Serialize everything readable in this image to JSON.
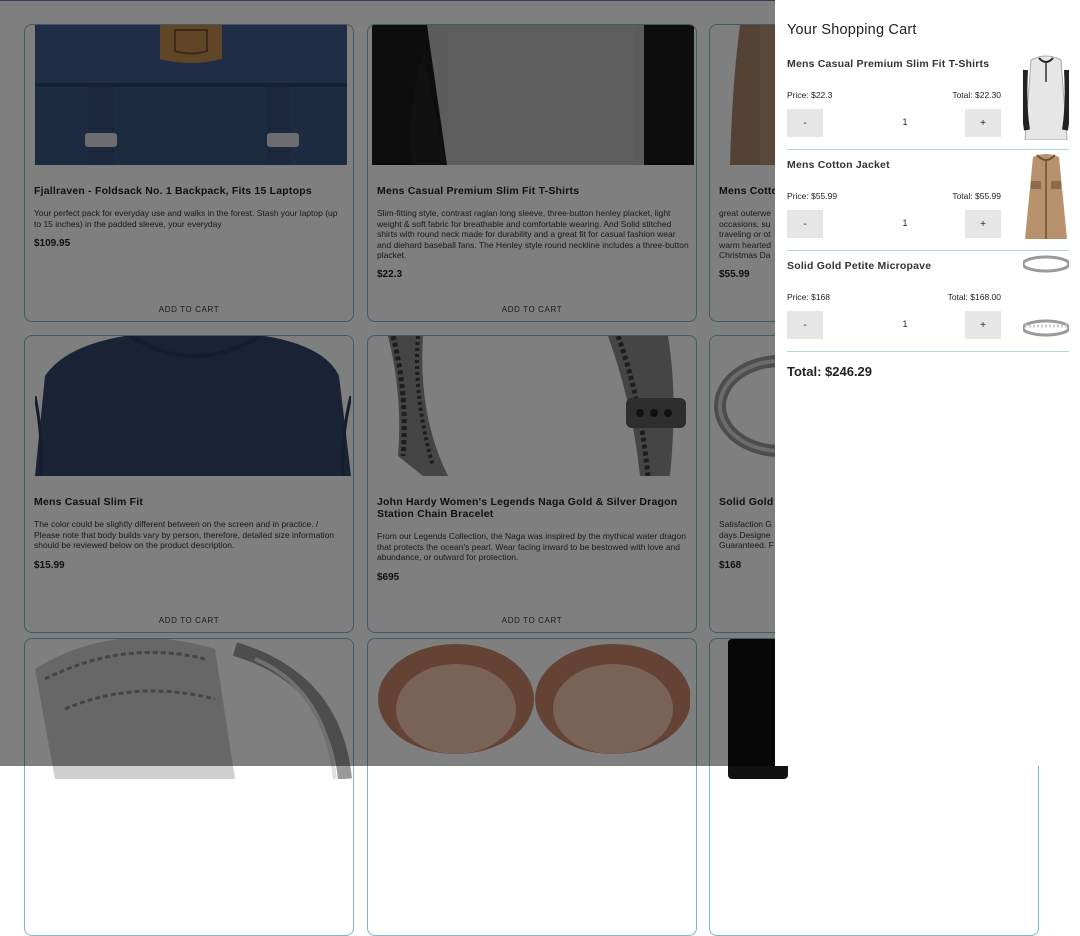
{
  "products": [
    {
      "title": "Fjallraven - Foldsack No. 1 Backpack, Fits 15 Laptops",
      "description": "Your perfect pack for everyday use and walks in the forest. Stash your laptop (up to 15 inches) in the padded sleeve, your everyday",
      "price": "$109.95",
      "button": "ADD TO CART",
      "icon": "backpack-image"
    },
    {
      "title": "Mens Casual Premium Slim Fit T-Shirts",
      "description": "Slim-fitting style, contrast raglan long sleeve, three-button henley placket, light weight & soft fabric for breathable and comfortable wearing. And Solid stitched shirts with round neck made for durability and a great fit for casual fashion wear and diehard baseball fans. The Henley style round neckline includes a three-button placket.",
      "price": "$22.3",
      "button": "ADD TO CART",
      "icon": "tshirt-image"
    },
    {
      "title": "Mens Cotto",
      "description": "great outerwe occasions, su traveling or ot warm hearted Christmas Da",
      "price": "$55.99",
      "button": "",
      "icon": "jacket-image"
    },
    {
      "title": "Mens Casual Slim Fit",
      "description": "The color could be slightly different between on the screen and in practice. / Please note that body builds vary by person, therefore, detailed size information should be reviewed below on the product description.",
      "price": "$15.99",
      "button": "ADD TO CART",
      "icon": "longsleeve-shirt-image"
    },
    {
      "title": "John Hardy Women's Legends Naga Gold & Silver Dragon Station Chain Bracelet",
      "description": "From our Legends Collection, the Naga was inspired by the mythical water dragon that protects the ocean's pearl. Wear facing inward to be bestowed with love and abundance, or outward for protection.",
      "price": "$695",
      "button": "ADD TO CART",
      "icon": "bracelet-image"
    },
    {
      "title": "Solid Gold",
      "description": "Satisfaction G days.Designe Guaranteed. F",
      "price": "$168",
      "button": "",
      "icon": "ring-image"
    },
    {
      "title": "",
      "description": "",
      "price": "",
      "button": "",
      "icon": "diamond-ring-image"
    },
    {
      "title": "",
      "description": "",
      "price": "",
      "button": "",
      "icon": "rose-gold-rings-image"
    },
    {
      "title": "",
      "description": "",
      "price": "",
      "button": "",
      "icon": "hard-drive-image"
    }
  ],
  "cart": {
    "title": "Your Shopping Cart",
    "items": [
      {
        "title": "Mens Casual Premium Slim Fit T-Shirts",
        "price": "Price: $22.3",
        "total": "Total: $22.30",
        "minus": "-",
        "qty": "1",
        "plus": "+",
        "icon": "tshirt-thumbnail"
      },
      {
        "title": "Mens Cotton Jacket",
        "price": "Price: $55.99",
        "total": "Total: $55.99",
        "minus": "-",
        "qty": "1",
        "plus": "+",
        "icon": "jacket-thumbnail"
      },
      {
        "title": "Solid Gold Petite Micropave",
        "price": "Price: $168",
        "total": "Total: $168.00",
        "minus": "-",
        "qty": "1",
        "plus": "+",
        "icon": "ring-thumbnail"
      }
    ],
    "grand_total": "Total: $246.29"
  },
  "colors": {
    "card_border": "#7fb7c6",
    "overlay": "rgba(0,0,0,0.5)",
    "qty_button": "#e6e6e6",
    "separator": "#b7d7de"
  }
}
